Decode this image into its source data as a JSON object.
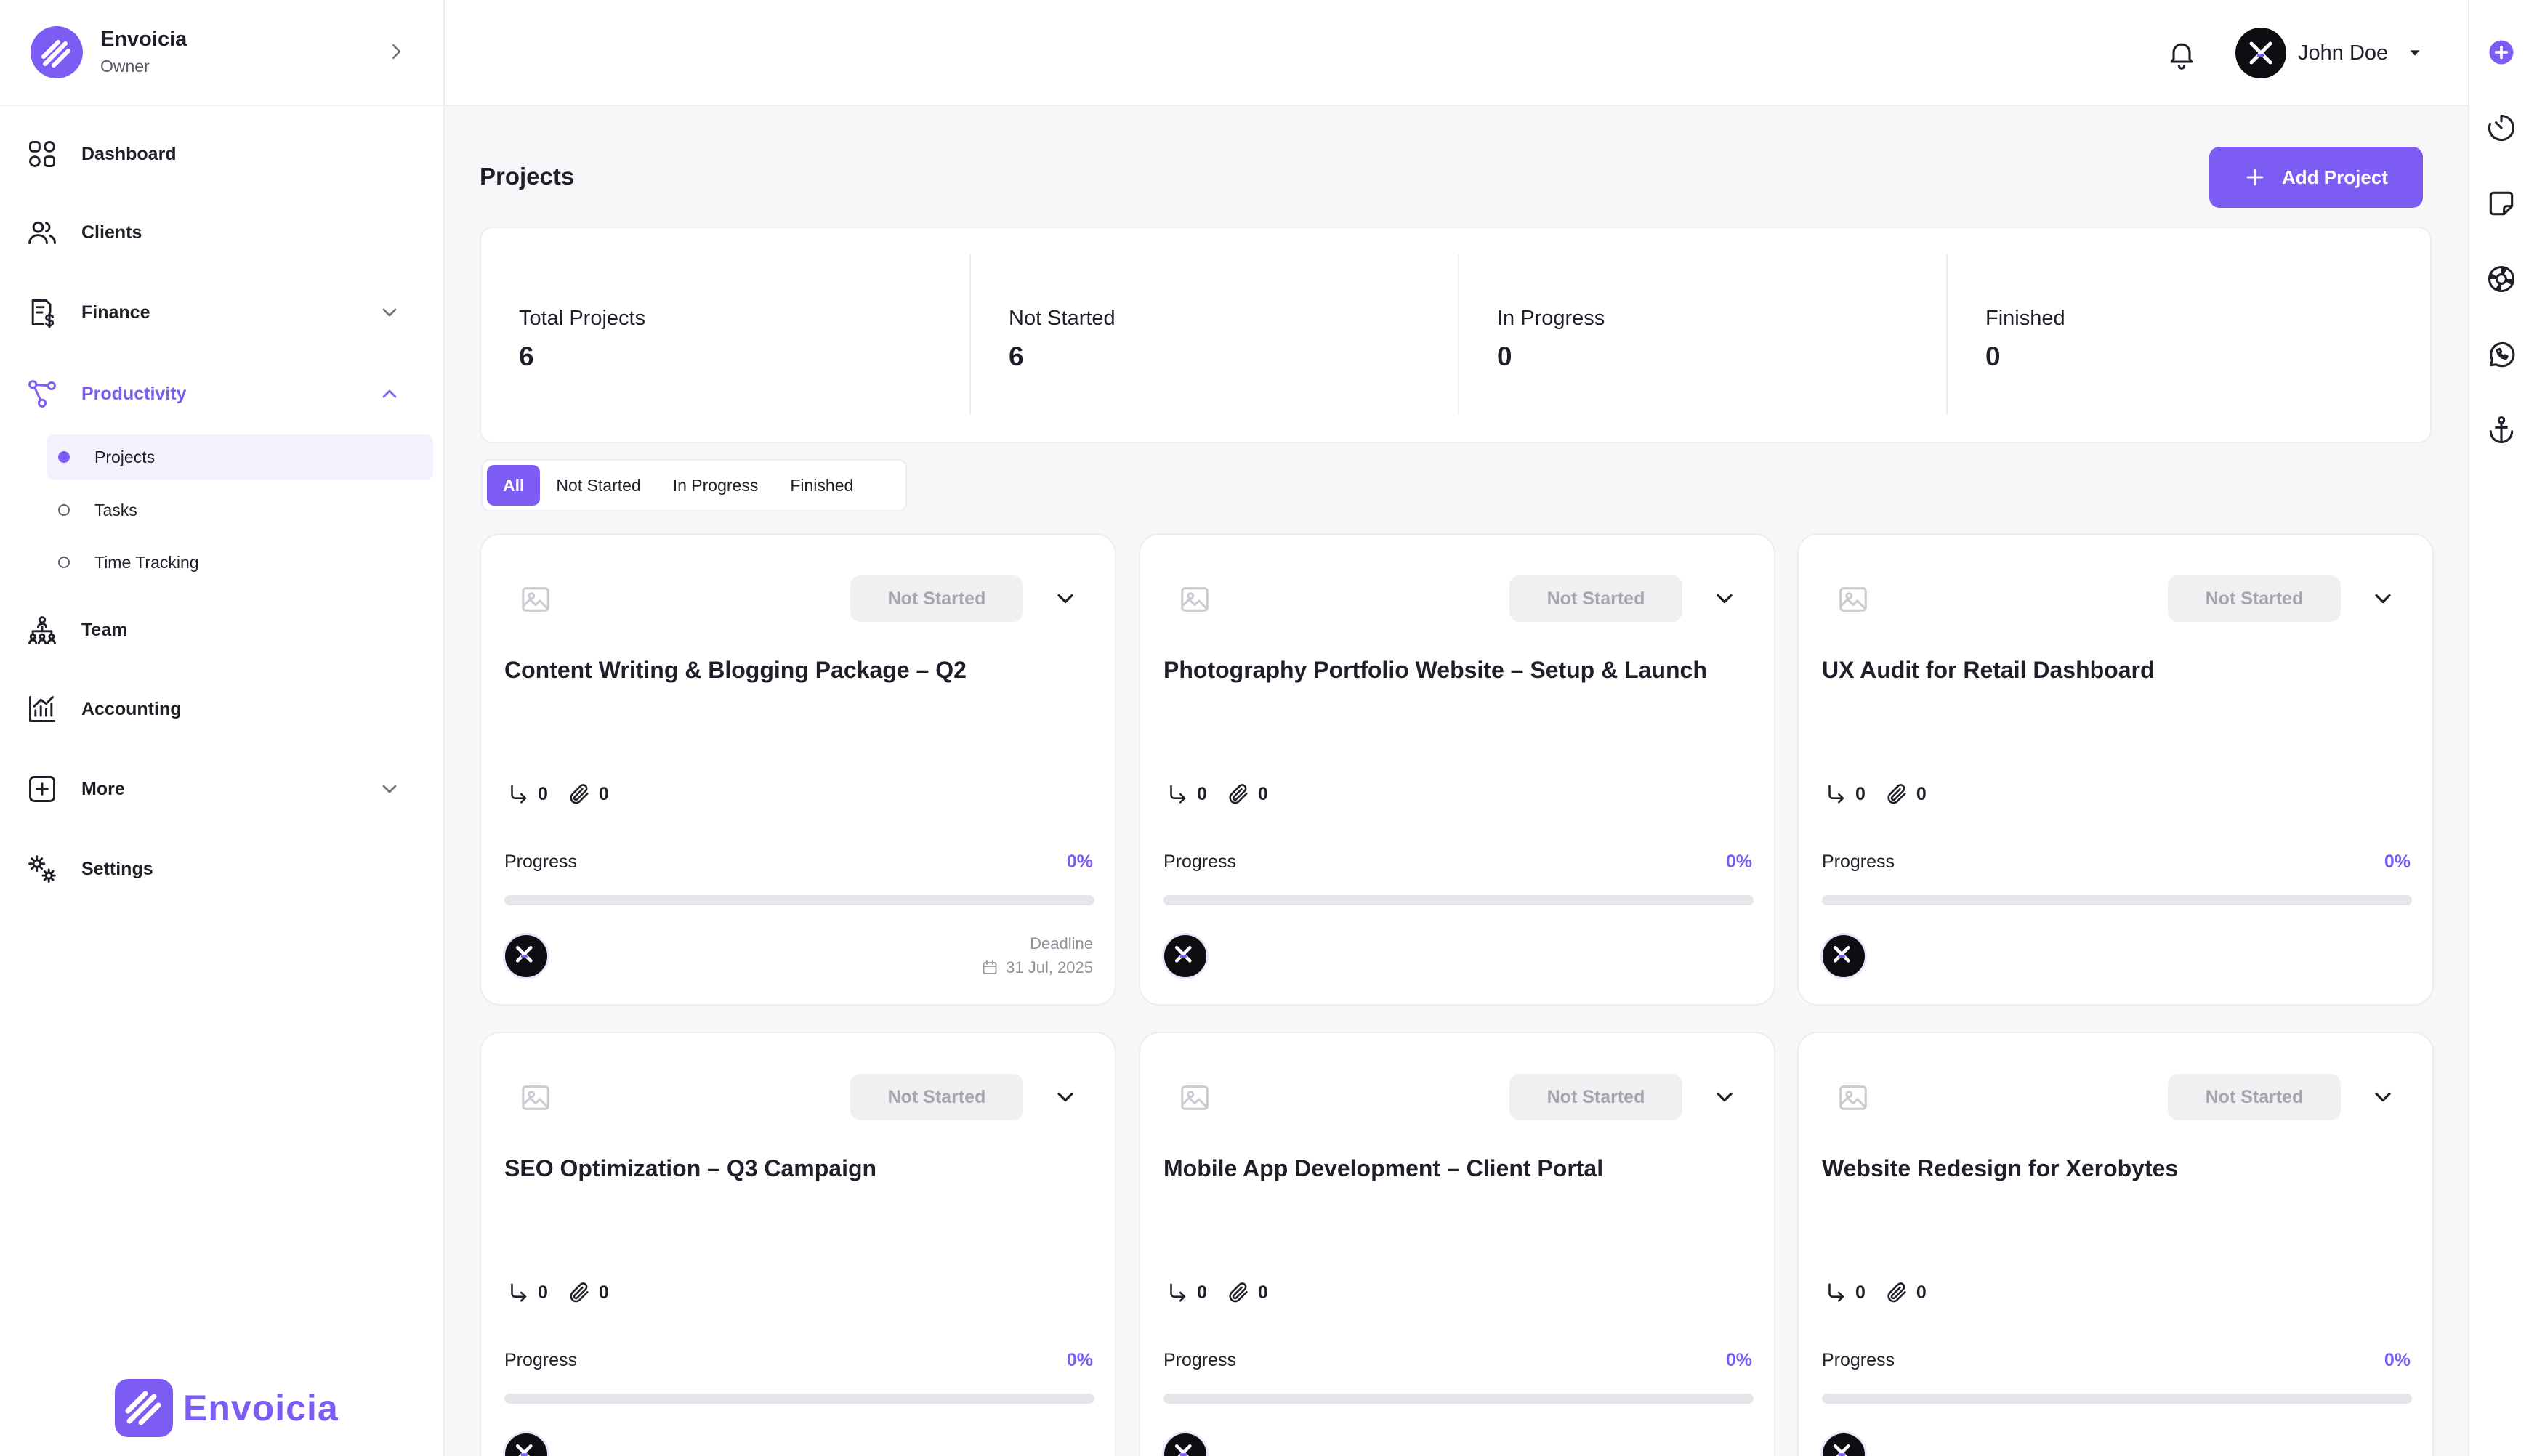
{
  "org": {
    "name": "Envoicia",
    "role": "Owner"
  },
  "nav": {
    "dashboard": "Dashboard",
    "clients": "Clients",
    "finance": "Finance",
    "productivity": "Productivity",
    "projects": "Projects",
    "tasks": "Tasks",
    "time_tracking": "Time Tracking",
    "team": "Team",
    "accounting": "Accounting",
    "more": "More",
    "settings": "Settings"
  },
  "brand_footer": "Envoicia",
  "user": {
    "name": "John Doe"
  },
  "page": {
    "title": "Projects",
    "add_button": "Add Project"
  },
  "stats": [
    {
      "label": "Total Projects",
      "value": "6"
    },
    {
      "label": "Not Started",
      "value": "6"
    },
    {
      "label": "In Progress",
      "value": "0"
    },
    {
      "label": "Finished",
      "value": "0"
    }
  ],
  "filters": [
    "All",
    "Not Started",
    "In Progress",
    "Finished"
  ],
  "active_filter": "All",
  "progress_label": "Progress",
  "deadline_label": "Deadline",
  "projects": [
    {
      "title": "Content Writing & Blogging Package – Q2",
      "status": "Not Started",
      "subtasks": "0",
      "attachments": "0",
      "progress": 0,
      "progress_text": "0%",
      "deadline": "31 Jul, 2025"
    },
    {
      "title": "Photography Portfolio Website – Setup & Launch",
      "status": "Not Started",
      "subtasks": "0",
      "attachments": "0",
      "progress": 0,
      "progress_text": "0%",
      "deadline": ""
    },
    {
      "title": "UX Audit for Retail Dashboard",
      "status": "Not Started",
      "subtasks": "0",
      "attachments": "0",
      "progress": 0,
      "progress_text": "0%",
      "deadline": ""
    },
    {
      "title": "SEO Optimization – Q3 Campaign",
      "status": "Not Started",
      "subtasks": "0",
      "attachments": "0",
      "progress": 0,
      "progress_text": "0%",
      "deadline": ""
    },
    {
      "title": "Mobile App Development – Client Portal",
      "status": "Not Started",
      "subtasks": "0",
      "attachments": "0",
      "progress": 0,
      "progress_text": "0%",
      "deadline": ""
    },
    {
      "title": "Website Redesign for Xerobytes",
      "status": "Not Started",
      "subtasks": "0",
      "attachments": "0",
      "progress": 0,
      "progress_text": "0%",
      "deadline": ""
    }
  ],
  "colors": {
    "accent": "#7c5cf2",
    "status_bg": "#f0f0f2",
    "status_text": "#a3a6ad"
  },
  "icons": [
    "dashboard-icon",
    "clients-icon",
    "finance-icon",
    "productivity-icon",
    "team-icon",
    "accounting-icon",
    "more-icon",
    "settings-icon",
    "bell-icon",
    "timer-icon",
    "sticky-note-icon",
    "support-icon",
    "whatsapp-icon",
    "anchor-icon",
    "plus-icon",
    "image-placeholder-icon",
    "subtask-icon",
    "paperclip-icon",
    "calendar-icon"
  ]
}
